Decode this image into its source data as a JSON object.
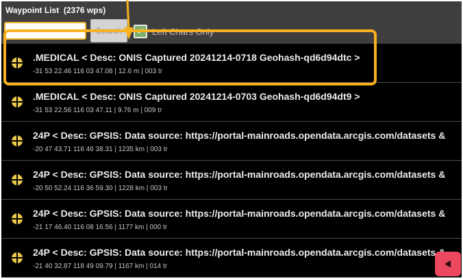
{
  "header": {
    "title": "Waypoint List",
    "count": "(2376 wps)"
  },
  "toolbar": {
    "search_value": "",
    "search_button_label": "Search",
    "checkbox_label": "Left Chars Only",
    "checkbox_checked": true
  },
  "waypoints": [
    {
      "title": ".MEDICAL < Desc: ONIS Captured 20241214-0718 Geohash-qd6d94dtc >",
      "details": "-31 53 22.46  116 03 47.08 | 12.6 m | 003 tr"
    },
    {
      "title": ".MEDICAL < Desc: ONIS Captured 20241214-0703 Geohash-qd6d94dt9 >",
      "details": "-31 53 22.56  116 03 47.11 | 9.76 m | 009 tr"
    },
    {
      "title": "24P < Desc: GPSIS: Data source: https://portal-mainroads.opendata.arcgis.com/datasets &",
      "details": "-20 47 43.71  116 46 38.31 | 1235 km | 003 tr"
    },
    {
      "title": "24P < Desc: GPSIS: Data source: https://portal-mainroads.opendata.arcgis.com/datasets &",
      "details": "-20 50 52.24  116 36 59.30 | 1228 km | 003 tr"
    },
    {
      "title": "24P < Desc: GPSIS: Data source: https://portal-mainroads.opendata.arcgis.com/datasets &",
      "details": "-21 17 46.40  116 08 16.56 | 1177 km | 000 tr"
    },
    {
      "title": "24P < Desc: GPSIS: Data source: https://portal-mainroads.opendata.arcgis.com/datasets &",
      "details": "-21 40 32.87  118 49 09.79 | 1167 km | 014 tr"
    }
  ],
  "colors": {
    "accent": "#f7b21d",
    "back_button": "#ec4860",
    "waypoint_icon": "#e9c84a"
  },
  "icons": {
    "waypoint": "crosshair-circle-icon",
    "back": "left-triangle-icon"
  }
}
